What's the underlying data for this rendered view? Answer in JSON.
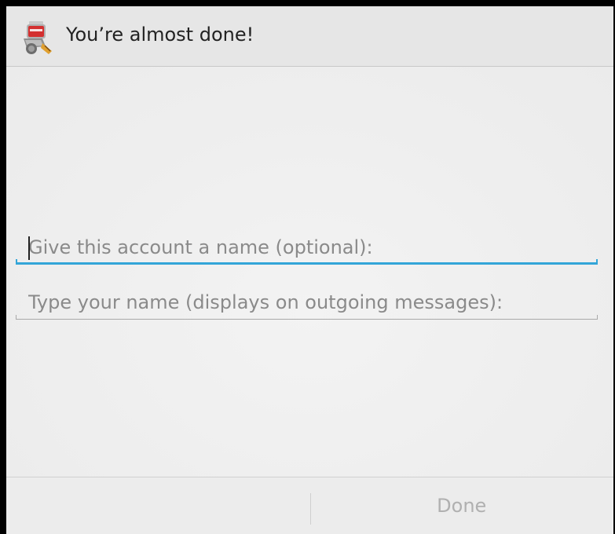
{
  "dialog": {
    "title": "You’re almost done!",
    "app_icon": "mail-app-icon"
  },
  "form": {
    "account_name": {
      "value": "",
      "placeholder": "Give this account a name (optional):",
      "focused": true
    },
    "your_name": {
      "value": "",
      "placeholder": "Type your name (displays on outgoing messages):",
      "focused": false
    }
  },
  "buttons": {
    "left_label": "",
    "done_label": "Done",
    "done_enabled": false
  },
  "colors": {
    "focus_accent": "#33a5d8",
    "disabled_text": "#b0b0b0"
  }
}
